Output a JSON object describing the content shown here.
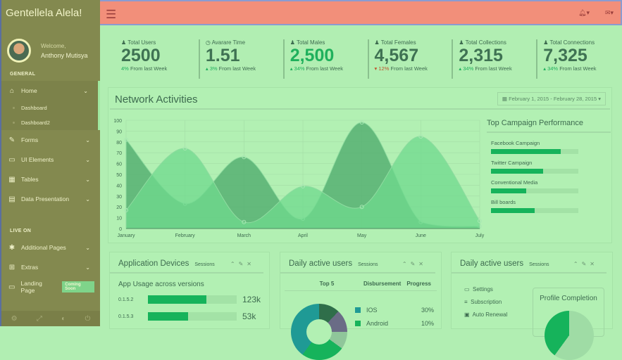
{
  "sidebar": {
    "brand": "Gentellela Alela!",
    "welcome": "Welcome,",
    "user": "Anthony Mutisya",
    "section1": "GENERAL",
    "section2": "LIVE ON",
    "items": [
      {
        "label": "Home",
        "icon": "home-icon"
      },
      {
        "label": "Forms",
        "icon": "edit-icon"
      },
      {
        "label": "UI Elements",
        "icon": "desktop-icon"
      },
      {
        "label": "Tables",
        "icon": "table-icon"
      },
      {
        "label": "Data Presentation",
        "icon": "chart-icon"
      }
    ],
    "home_sub": [
      "Dashboard",
      "Dashboard2"
    ],
    "live": [
      {
        "label": "Additional Pages",
        "icon": "bug-icon"
      },
      {
        "label": "Extras",
        "icon": "windows-icon"
      },
      {
        "label": "Landing Page",
        "icon": "laptop-icon",
        "badge": "Coming Soon"
      }
    ]
  },
  "tiles": [
    {
      "label": "Total Users",
      "value": "2500",
      "pct": "4%",
      "suffix": "From last Week"
    },
    {
      "label": "Avarare Time",
      "value": "1.51",
      "pct": "3%",
      "suffix": "From last Week"
    },
    {
      "label": "Total Males",
      "value": "2,500",
      "pct": "34%",
      "suffix": "From last Week"
    },
    {
      "label": "Total Females",
      "value": "4,567",
      "pct": "12%",
      "suffix": "From last Week"
    },
    {
      "label": "Total Collections",
      "value": "2,315",
      "pct": "34%",
      "suffix": "From last Week"
    },
    {
      "label": "Total Connections",
      "value": "7,325",
      "pct": "34%",
      "suffix": "From last Week"
    }
  ],
  "network": {
    "title": "Network Activities",
    "date_range": "February 1, 2015 - February 28, 2015"
  },
  "chart_data": {
    "type": "area",
    "categories": [
      "January",
      "February",
      "March",
      "April",
      "May",
      "June",
      "July"
    ],
    "ylim": [
      0,
      100
    ],
    "yticks": [
      0,
      10,
      20,
      30,
      40,
      50,
      60,
      70,
      80,
      90,
      100
    ],
    "grid": true,
    "series": [
      {
        "values": [
          82,
          23,
          66,
          9,
          98,
          6,
          2
        ],
        "color": "#4aa86a"
      },
      {
        "values": [
          17,
          74,
          6,
          39,
          20,
          85,
          7
        ],
        "color": "#6fd98d"
      }
    ]
  },
  "campaign": {
    "title": "Top Campaign Performance",
    "items": [
      {
        "label": "Facebook Campaign",
        "pct": 80
      },
      {
        "label": "Twitter Campaign",
        "pct": 60
      },
      {
        "label": "Conventional Media",
        "pct": 40
      },
      {
        "label": "Bill boards",
        "pct": 50
      }
    ]
  },
  "panels": {
    "p1": {
      "title": "Application Devices",
      "sub": "Sessions",
      "heading": "App Usage across versions",
      "rows": [
        {
          "v": "0.1.5.2",
          "n": "123k",
          "pct": 66
        },
        {
          "v": "0.1.5.3",
          "n": "53k",
          "pct": 45
        }
      ]
    },
    "p2": {
      "title": "Daily active users",
      "sub": "Sessions",
      "cols": [
        "Top 5",
        "Disbursement",
        "Progress"
      ],
      "rows": [
        {
          "l": "IOS",
          "p": "30%",
          "c": "#1f9a95"
        },
        {
          "l": "Android",
          "p": "10%",
          "c": "#16b35b"
        }
      ]
    },
    "p3": {
      "title": "Daily active users",
      "sub": "Sessions",
      "list": [
        "Settings",
        "Subscription",
        "Auto Renewal"
      ],
      "profile": "Profile Completion"
    }
  }
}
